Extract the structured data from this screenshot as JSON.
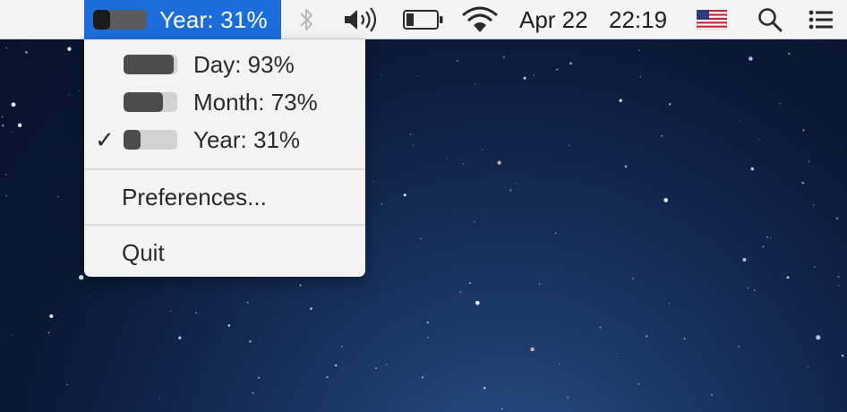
{
  "menubar": {
    "app_item": {
      "title": "Year: 31%",
      "progress": 0.31
    },
    "date": "Apr 22",
    "time": "22:19",
    "icons": {
      "bluetooth": "bluetooth-icon",
      "volume": "volume-icon",
      "battery": "battery-icon",
      "wifi": "wifi-icon",
      "flag": "us-flag-icon",
      "search": "spotlight-search-icon",
      "list": "notification-center-icon"
    }
  },
  "menu": {
    "items": [
      {
        "label": "Day: 93%",
        "progress": 0.93,
        "checked": false
      },
      {
        "label": "Month: 73%",
        "progress": 0.73,
        "checked": false
      },
      {
        "label": "Year: 31%",
        "progress": 0.31,
        "checked": true
      }
    ],
    "check_mark": "✓",
    "preferences_label": "Preferences...",
    "quit_label": "Quit"
  },
  "colors": {
    "menubar_bg": "#f4f4f4",
    "highlight": "#1c6ddc",
    "menu_bg": "#f3f3f3",
    "progress_fill": "#4c4c4c",
    "progress_track": "#d2d2d2"
  }
}
